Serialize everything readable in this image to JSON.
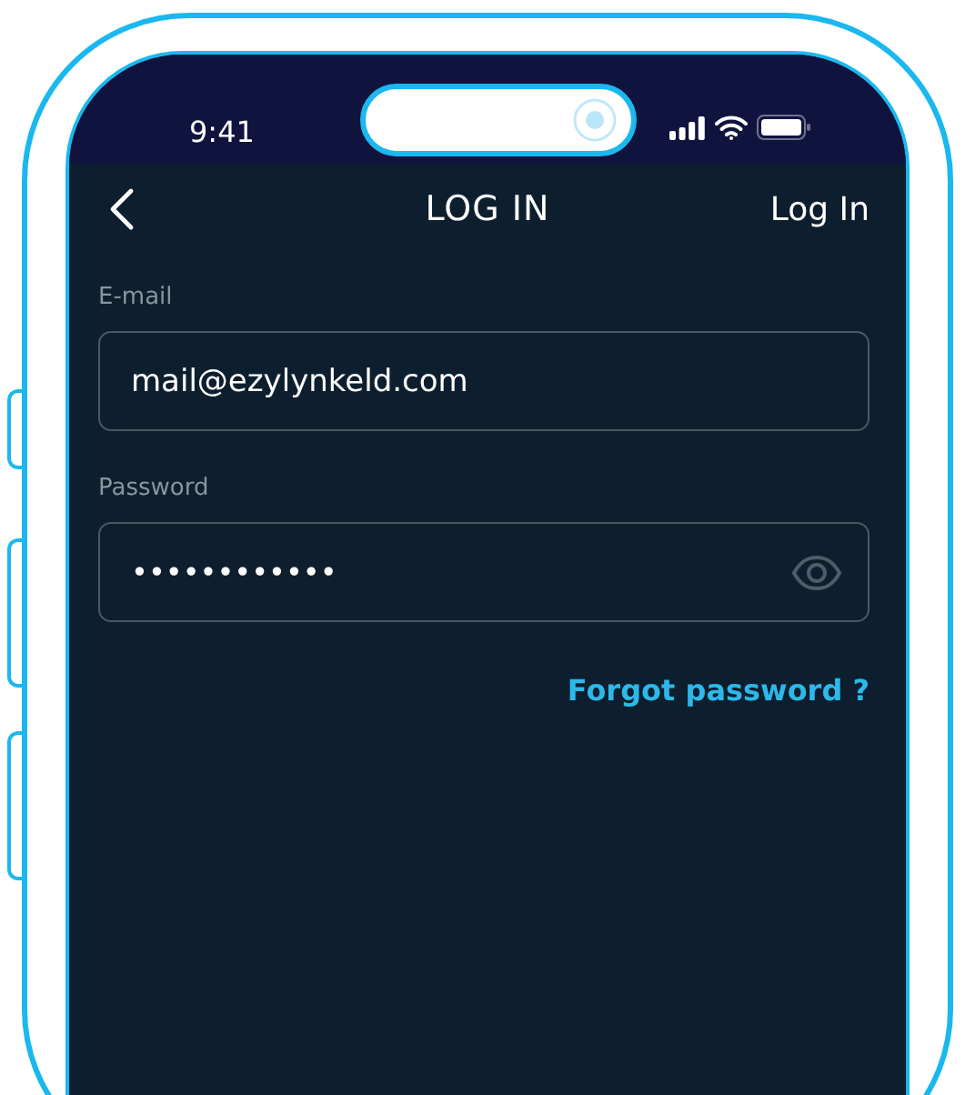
{
  "status_bar": {
    "time": "9:41"
  },
  "nav_bar": {
    "title": "LOG IN",
    "action": "Log In"
  },
  "fields": [
    {
      "label": "E-mail",
      "value": "mail@ezylynkeld.com",
      "kind": "text"
    },
    {
      "label": "Password",
      "value": "••••••••••••",
      "kind": "password"
    }
  ],
  "forgot_link": "Forgot password ?"
}
